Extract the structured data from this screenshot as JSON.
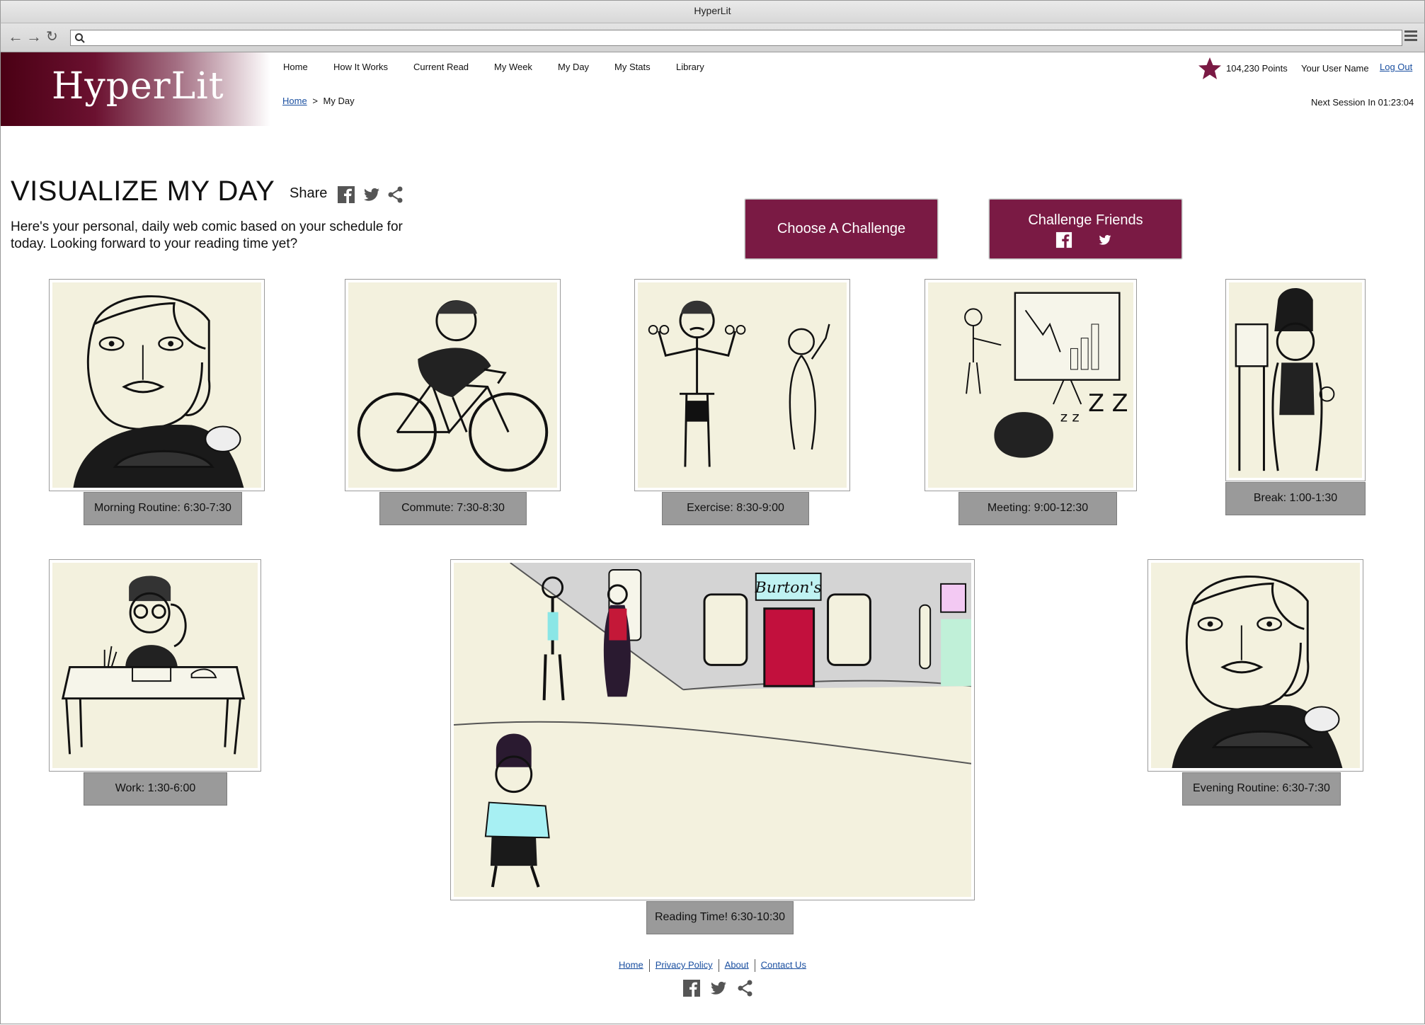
{
  "window": {
    "title": "HyperLit"
  },
  "brand": {
    "logo": "HyperLit",
    "accent": "#7a1a44"
  },
  "nav": {
    "items": [
      "Home",
      "How It Works",
      "Current Read",
      "My Week",
      "My Day",
      "My Stats",
      "Library"
    ]
  },
  "breadcrumb": {
    "home": "Home",
    "separator": ">",
    "current": "My Day"
  },
  "user": {
    "points": "104,230 Points",
    "name": "Your User Name",
    "logout": "Log Out",
    "next_session": "Next Session In 01:23:04"
  },
  "heading": {
    "title": "VISUALIZE MY DAY",
    "share": "Share",
    "intro": "Here's your personal, daily web comic based on your schedule for today. Looking forward to your reading time yet?"
  },
  "buttons": {
    "choose": "Choose A Challenge",
    "challenge_friends": "Challenge Friends"
  },
  "panels": [
    {
      "caption": "Morning Routine: 6:30-7:30"
    },
    {
      "caption": "Commute: 7:30-8:30"
    },
    {
      "caption": "Exercise: 8:30-9:00"
    },
    {
      "caption": "Meeting: 9:00-12:30"
    },
    {
      "caption": "Break: 1:00-1:30"
    },
    {
      "caption": "Work: 1:30-6:00"
    },
    {
      "caption": "Reading Time! 6:30-10:30",
      "shop_sign": "Burton's"
    },
    {
      "caption": "Evening Routine: 6:30-7:30"
    }
  ],
  "footer": {
    "links": [
      "Home",
      "Privacy Policy",
      "About",
      "Contact Us"
    ]
  },
  "icons": [
    "back-arrow-icon",
    "forward-arrow-icon",
    "reload-icon",
    "search-icon",
    "menu-icon",
    "star-icon",
    "facebook-icon",
    "twitter-icon",
    "share-icon"
  ]
}
